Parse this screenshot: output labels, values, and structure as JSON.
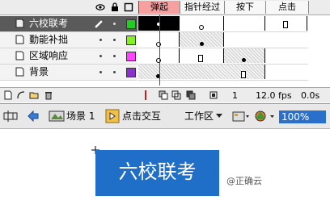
{
  "timeline": {
    "frame_labels": [
      "弹起",
      "指针经过",
      "按下",
      "点击"
    ],
    "active_frame_label": "弹起",
    "layers": [
      {
        "name": "六校联考",
        "color": "#22cc22",
        "selected": true
      },
      {
        "name": "勤能补拙",
        "color": "#88ee22",
        "selected": false
      },
      {
        "name": "区域响应",
        "color": "#ff44ff",
        "selected": false
      },
      {
        "name": "背景",
        "color": "#8833cc",
        "selected": false
      }
    ],
    "current_frame": "1",
    "fps": "12.0 fps",
    "time": "0.0s"
  },
  "editbar": {
    "scene_label": "场景 1",
    "symbol_label": "点击交互",
    "workspace_label": "工作区",
    "zoom_value": "100%"
  },
  "stage": {
    "button_text": "六校联考",
    "watermark": "@正确云"
  }
}
